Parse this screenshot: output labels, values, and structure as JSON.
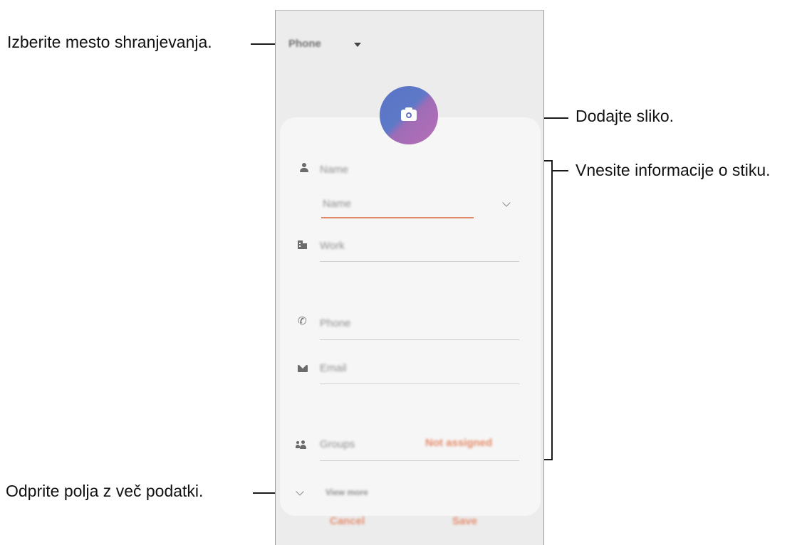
{
  "callouts": {
    "storage": "Izberite mesto shranjevanja.",
    "photo": "Dodajte sliko.",
    "info": "Vnesite informacije o stiku.",
    "more": "Odprite polja z več podatki."
  },
  "screen": {
    "storage_label": "Phone",
    "fields": {
      "name_header": "Name",
      "name_input": "Name",
      "work": "Work",
      "phone": "Phone",
      "email": "Email",
      "groups": "Groups",
      "groups_value": "Not assigned",
      "view_more": "View more"
    },
    "buttons": {
      "cancel": "Cancel",
      "save": "Save"
    }
  },
  "colors": {
    "accent": "#e2886a",
    "avatar_gradient_start": "#5b74c6",
    "avatar_gradient_end": "#b76fb6"
  }
}
